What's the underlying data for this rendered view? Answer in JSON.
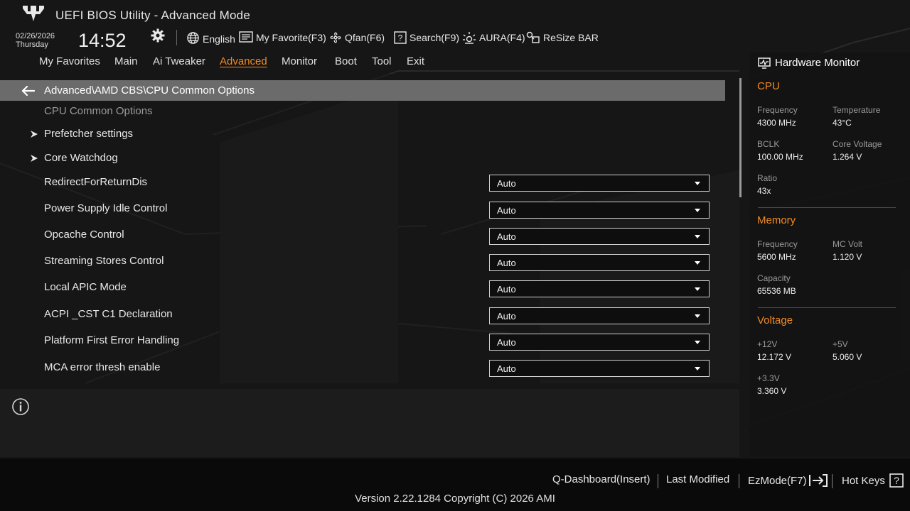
{
  "app": {
    "title": "UEFI BIOS Utility - Advanced Mode",
    "date": "02/26/2026",
    "weekday": "Thursday",
    "time": "14:52"
  },
  "toolbar": {
    "language": "English",
    "my_favorite": "My Favorite(F3)",
    "qfan": "Qfan(F6)",
    "search": "Search(F9)",
    "aura": "AURA(F4)",
    "resize_bar": "ReSize BAR"
  },
  "tabs": [
    "My Favorites",
    "Main",
    "Ai Tweaker",
    "Advanced",
    "Monitor",
    "Boot",
    "Tool",
    "Exit"
  ],
  "active_tab": "Advanced",
  "breadcrumb": "Advanced\\AMD CBS\\CPU Common Options",
  "section_heading": "CPU Common Options",
  "submenus": [
    "Prefetcher settings",
    "Core Watchdog"
  ],
  "options": [
    {
      "label": "RedirectForReturnDis",
      "value": "Auto"
    },
    {
      "label": "Power Supply Idle Control",
      "value": "Auto"
    },
    {
      "label": "Opcache Control",
      "value": "Auto"
    },
    {
      "label": "Streaming Stores Control",
      "value": "Auto"
    },
    {
      "label": "Local APIC Mode",
      "value": "Auto"
    },
    {
      "label": "ACPI _CST C1 Declaration",
      "value": "Auto"
    },
    {
      "label": "Platform First Error Handling",
      "value": "Auto"
    },
    {
      "label": "MCA error thresh enable",
      "value": "Auto"
    }
  ],
  "hardware_monitor": {
    "title": "Hardware Monitor",
    "cpu": {
      "heading": "CPU",
      "frequency_label": "Frequency",
      "frequency": "4300 MHz",
      "temperature_label": "Temperature",
      "temperature": "43°C",
      "bclk_label": "BCLK",
      "bclk": "100.00 MHz",
      "core_voltage_label": "Core Voltage",
      "core_voltage": "1.264 V",
      "ratio_label": "Ratio",
      "ratio": "43x"
    },
    "memory": {
      "heading": "Memory",
      "frequency_label": "Frequency",
      "frequency": "5600 MHz",
      "mc_volt_label": "MC Volt",
      "mc_volt": "1.120 V",
      "capacity_label": "Capacity",
      "capacity": "65536 MB"
    },
    "voltage": {
      "heading": "Voltage",
      "v12_label": "+12V",
      "v12": "12.172 V",
      "v5_label": "+5V",
      "v5": "5.060 V",
      "v33_label": "+3.3V",
      "v33": "3.360 V"
    }
  },
  "bottom": {
    "q_dashboard": "Q-Dashboard(Insert)",
    "last_modified": "Last Modified",
    "ezmode": "EzMode(F7)",
    "hot_keys": "Hot Keys",
    "version": "Version 2.22.1284 Copyright (C) 2026 AMI"
  },
  "colors": {
    "accent": "#f08a24",
    "background": "#161616",
    "breadcrumb_bar": "#6b6b6b"
  }
}
